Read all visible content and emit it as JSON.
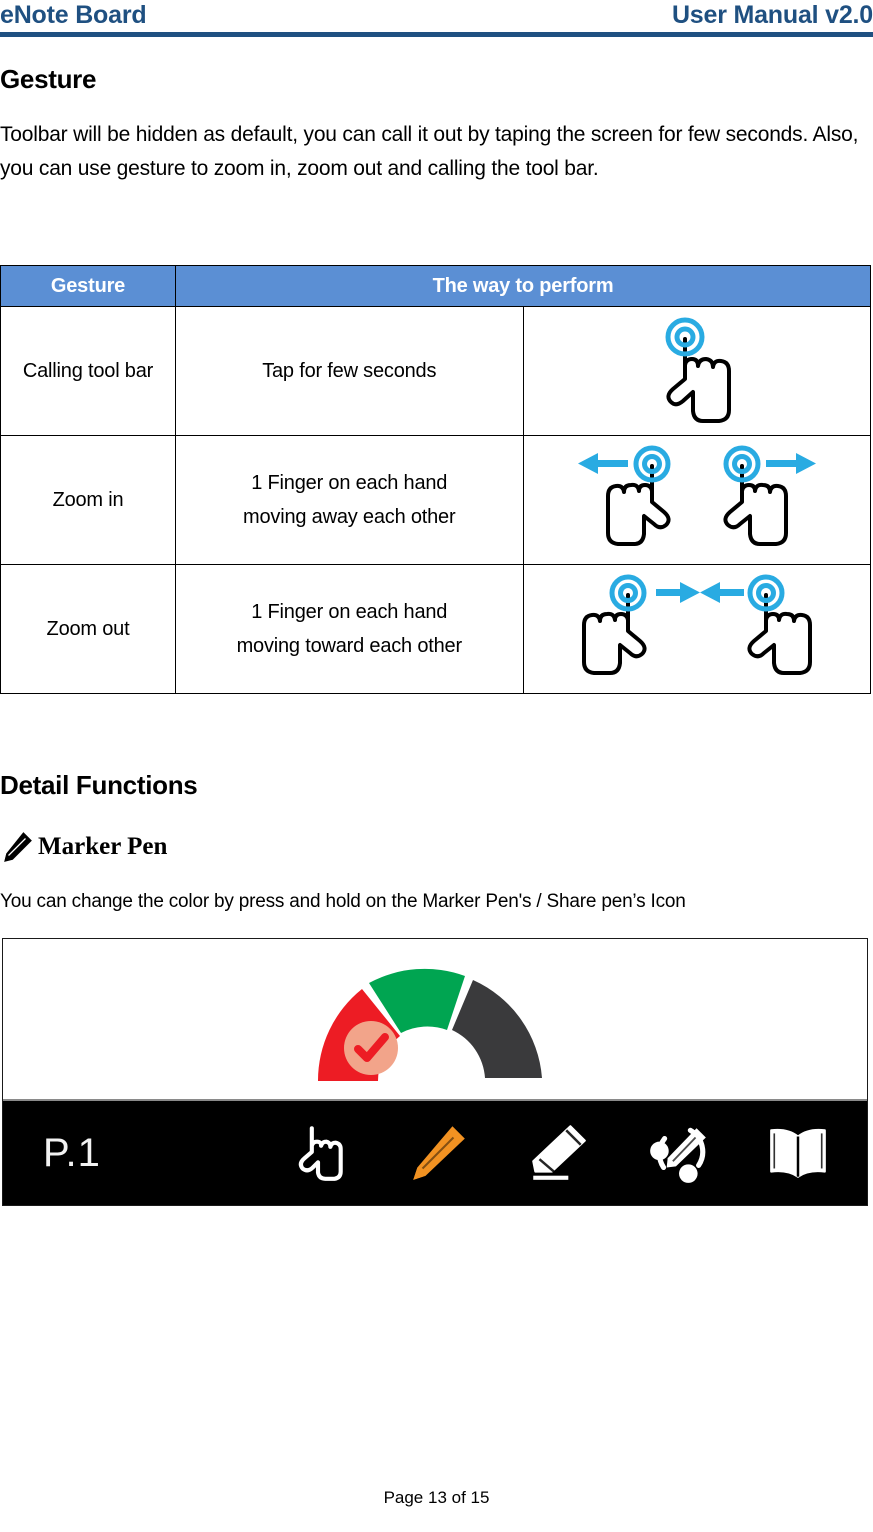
{
  "header": {
    "doc_title": "eNote Board",
    "version": "User Manual v2.0",
    "rule_color": "#1F5081"
  },
  "sections": {
    "gesture": {
      "heading": "Gesture",
      "intro": "Toolbar will be hidden as default, you can call it out by taping the screen for few seconds. Also, you can use gesture to zoom in, zoom out and calling the tool bar."
    },
    "detail": {
      "heading": "Detail Functions",
      "subheading": "Marker Pen",
      "subheading_icon": "pencil-icon",
      "description": "You can change the color by press and hold on the Marker Pen's / Share pen’s Icon"
    }
  },
  "gesture_table": {
    "header_bg": "#5B8FD4",
    "columns": [
      "Gesture",
      "The way to perform"
    ],
    "rows": [
      {
        "gesture": "Calling tool bar",
        "perform_line1": "Tap for few seconds",
        "perform_line2": "",
        "figure": "one-finger-tap-icon"
      },
      {
        "gesture": "Zoom in",
        "perform_line1": "1 Finger on each hand",
        "perform_line2": "moving away each other",
        "figure": "two-hands-spread-icon"
      },
      {
        "gesture": "Zoom out",
        "perform_line1": "1 Finger on each hand",
        "perform_line2": "moving toward each other",
        "figure": "two-hands-pinch-icon"
      }
    ]
  },
  "device_screenshot": {
    "color_picker": {
      "segments": [
        {
          "name": "red-color-swatch",
          "color": "#ED1C24",
          "selected": true
        },
        {
          "name": "green-color-swatch",
          "color": "#00A551",
          "selected": false
        },
        {
          "name": "dark-color-swatch",
          "color": "#3A3A3C",
          "selected": false
        }
      ],
      "check_fill": "#F2A48A"
    },
    "toolbar": {
      "page_label": "P.1",
      "background": "#000000",
      "icons": [
        {
          "name": "select-hand-icon",
          "color": "#FFFFFF",
          "active": false
        },
        {
          "name": "marker-pen-icon",
          "color": "#F29222",
          "active": true
        },
        {
          "name": "eraser-icon",
          "color": "#FFFFFF",
          "active": false
        },
        {
          "name": "share-pen-icon",
          "color": "#FFFFFF",
          "active": false
        },
        {
          "name": "book-icon",
          "color": "#FFFFFF",
          "active": false
        }
      ]
    }
  },
  "footer": {
    "page_label": "Page 13 of 15"
  }
}
